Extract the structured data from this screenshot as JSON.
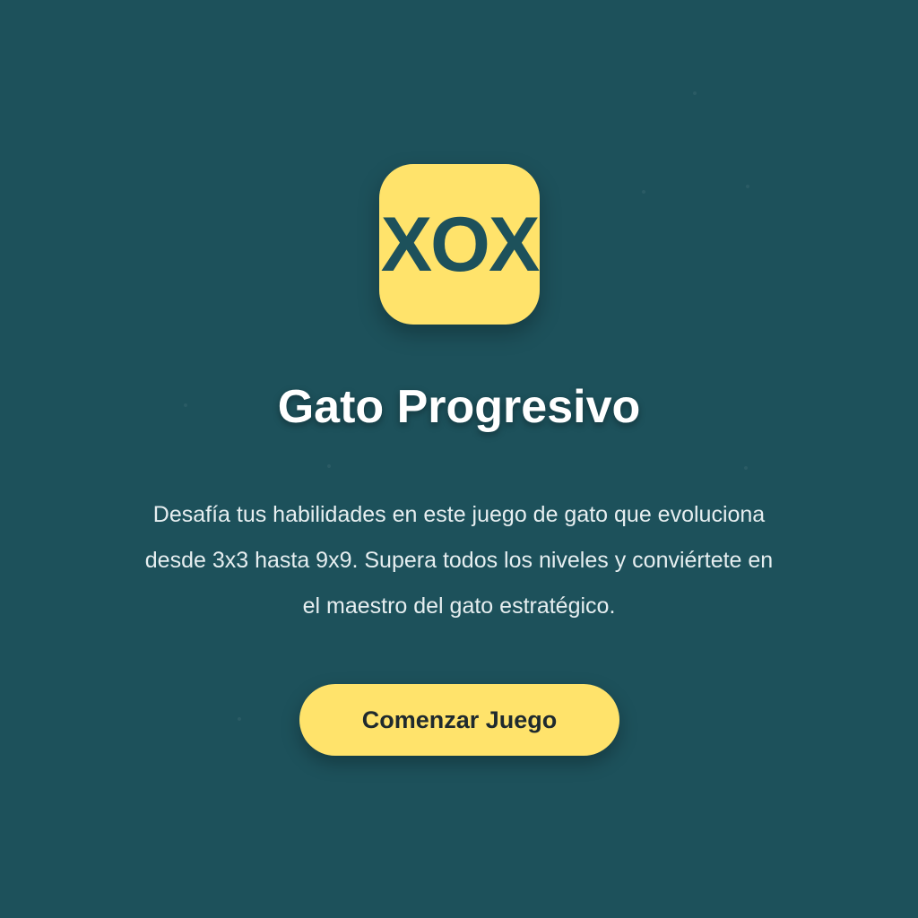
{
  "app": {
    "logo_text": "XOX",
    "title": "Gato Progresivo",
    "description": "Desafía tus habilidades en este juego de gato que evoluciona desde 3x3 hasta 9x9. Supera todos los niveles y conviértete en el maestro del gato estratégico.",
    "start_button_label": "Comenzar Juego"
  },
  "colors": {
    "background": "#1d515b",
    "accent": "#ffe36b",
    "text_primary": "#ffffff",
    "button_text": "#1f2a2e"
  }
}
